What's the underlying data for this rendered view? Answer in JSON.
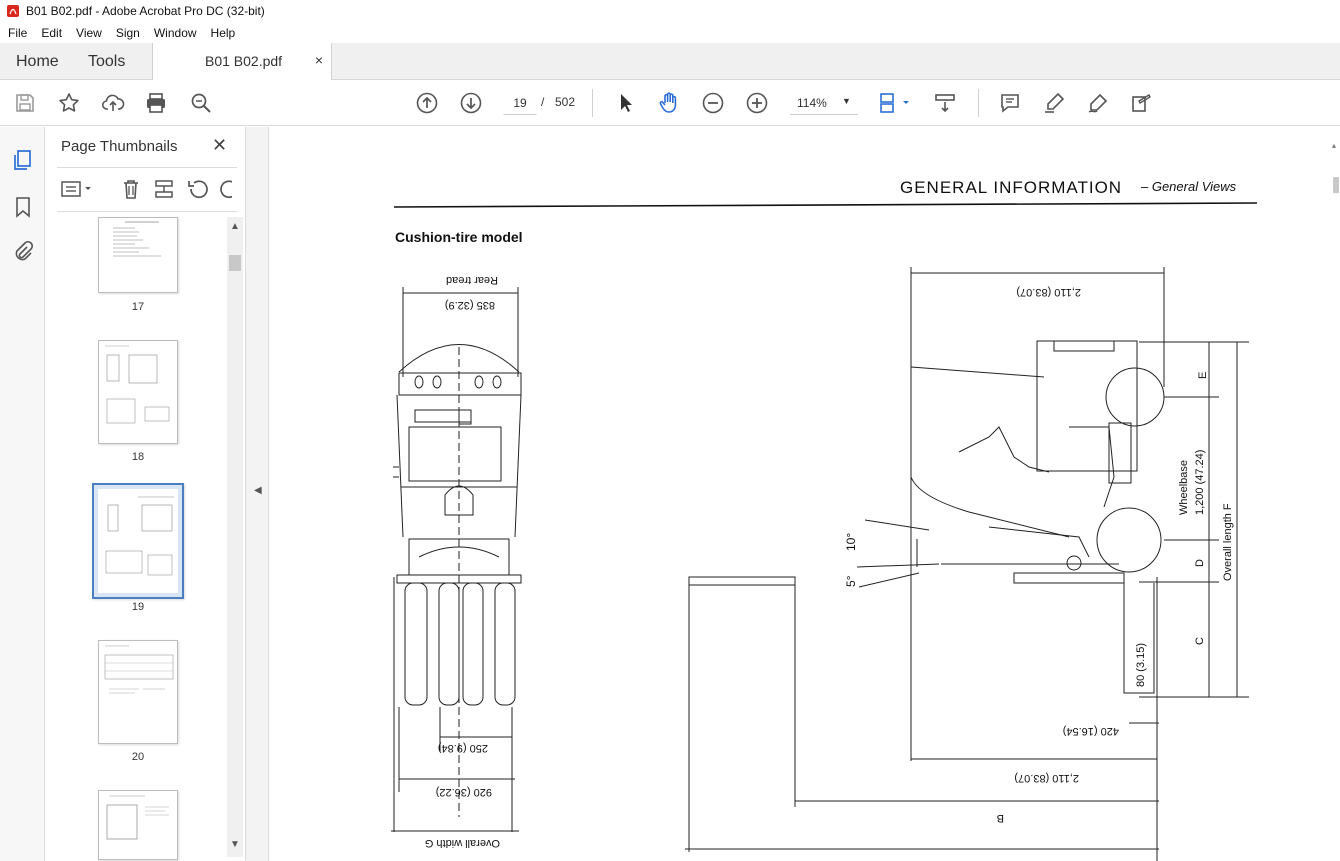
{
  "window": {
    "title": "B01 B02.pdf - Adobe Acrobat Pro DC (32-bit)",
    "icon": "pdf-app-icon"
  },
  "menu": [
    "File",
    "Edit",
    "View",
    "Sign",
    "Window",
    "Help"
  ],
  "tabs": {
    "home": "Home",
    "tools": "Tools",
    "document": "B01 B02.pdf",
    "close": "×"
  },
  "toolbar": {
    "icons": [
      "save-icon",
      "star-icon",
      "upload-icon",
      "print-icon",
      "find-icon",
      "prev-page-icon",
      "next-page-icon",
      "select-icon",
      "hand-icon",
      "zoom-out-icon",
      "zoom-in-icon",
      "fit-icon",
      "scroll-mode-icon",
      "comment-icon",
      "highlight-icon",
      "sign-icon",
      "more-tools-icon"
    ],
    "current_page": "19",
    "page_sep": "/",
    "total_pages": "502",
    "zoom": "114%"
  },
  "sidepanel": {
    "title": "Page Thumbnails",
    "close": "✕",
    "thumbnails": [
      {
        "label": "17",
        "selected": false
      },
      {
        "label": "18",
        "selected": false
      },
      {
        "label": "19",
        "selected": true
      },
      {
        "label": "20",
        "selected": false
      },
      {
        "label": "",
        "selected": false
      }
    ]
  },
  "document": {
    "header": "GENERAL  INFORMATION",
    "header_sub": "– General Views",
    "section_title": "Cushion-tire  model",
    "dims": {
      "rear_tread": "Rear tread",
      "rear_tread_val": "835 (32.9)",
      "fork_width": "250 (9.84)",
      "overall_width_val": "920 (36.22)",
      "overall_width": "Overall width G",
      "top_len": "2,110 (83.07)",
      "bottom_len": "2,110 (83.07)",
      "overhang": "420 (16.54)",
      "fork_height": "80 (3.15)",
      "wheelbase_label": "Wheelbase",
      "wheelbase_val": "1,200 (47.24)",
      "overall_length": "Overall length  F",
      "tilt_back": "10°",
      "tilt_fwd": "5°",
      "E": "E",
      "D": "D",
      "C": "C",
      "B": "B"
    }
  }
}
